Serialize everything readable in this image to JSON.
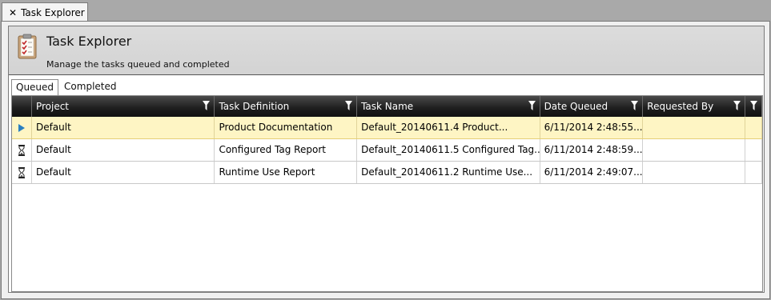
{
  "document_tab": {
    "close_glyph": "✕",
    "label": "Task Explorer"
  },
  "header": {
    "icon": "clipboard-checklist-icon",
    "title": "Task Explorer",
    "subtitle": "Manage the tasks queued and completed"
  },
  "tabs": [
    {
      "label": "Queued",
      "active": true
    },
    {
      "label": "Completed",
      "active": false
    }
  ],
  "grid": {
    "columns": [
      "Project",
      "Task Definition",
      "Task Name",
      "Date Queued",
      "Requested By"
    ],
    "rows": [
      {
        "indicator": "current-row-arrow-icon",
        "project": "Default",
        "task_definition": "Product Documentation",
        "task_name": "Default_20140611.4 Product...",
        "date_queued": "6/11/2014 2:48:55...",
        "requested_by": ""
      },
      {
        "indicator": "hourglass-icon",
        "project": "Default",
        "task_definition": "Configured Tag Report",
        "task_name": "Default_20140611.5 Configured Tag...",
        "date_queued": "6/11/2014 2:48:59...",
        "requested_by": ""
      },
      {
        "indicator": "hourglass-icon",
        "project": "Default",
        "task_definition": "Runtime Use Report",
        "task_name": "Default_20140611.2 Runtime Use...",
        "date_queued": "6/11/2014 2:49:07...",
        "requested_by": ""
      }
    ]
  },
  "colors": {
    "selected_row": "#fef5c4",
    "header_dark": "#1d1d1d",
    "indicator_arrow": "#2a7fc0"
  }
}
